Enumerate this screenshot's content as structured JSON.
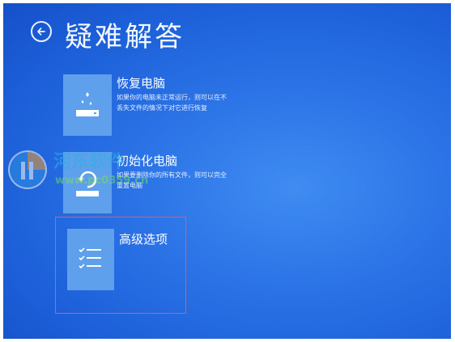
{
  "header": {
    "back_icon": "back-arrow-circle-icon",
    "title": "疑难解答"
  },
  "options": [
    {
      "title": "恢复电脑",
      "description": "如果你的电脑未正常运行，则可以在不丢失文件的情况下对它进行恢复",
      "icon": "refresh-pc-icon"
    },
    {
      "title": "初始化电脑",
      "description": "如果要删除你的所有文件，则可以完全重置电脑",
      "icon": "reset-pc-icon"
    },
    {
      "title": "高级选项",
      "description": "",
      "icon": "checklist-icon"
    }
  ],
  "watermark": {
    "text": "河东软件",
    "url": "www.pc0359.cn"
  },
  "colors": {
    "background": "#2a72e6",
    "tile": "#5fa0ec",
    "highlight_border": "#d0607a",
    "text": "#ffffff"
  }
}
